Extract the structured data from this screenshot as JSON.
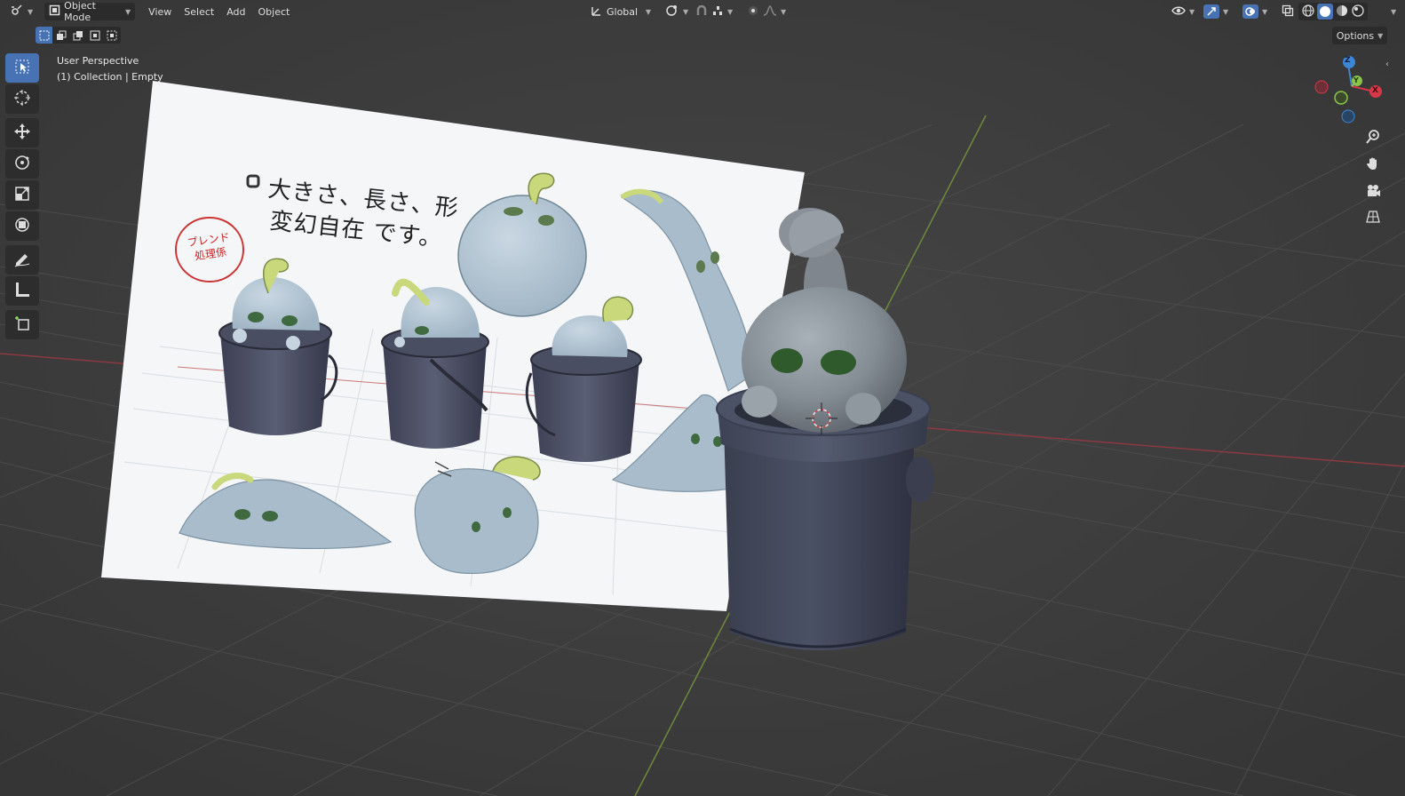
{
  "header": {
    "editor_type_icon": "viewport-editor-icon",
    "mode": "Object Mode",
    "menus": [
      "View",
      "Select",
      "Add",
      "Object"
    ],
    "transform_orientation": "Global",
    "pivot_icon": "pivot-point-icon",
    "snap_icon": "snap-magnet-icon",
    "proportional_icon": "proportional-edit-icon"
  },
  "viewport": {
    "perspective_label": "User Perspective",
    "collection_label": "(1) Collection | Empty",
    "options_label": "Options"
  },
  "gizmo": {
    "z": "Z",
    "y": "Y",
    "x": "X"
  },
  "reference_sheet": {
    "line1": "大きさ、長さ、形",
    "line2": "変幻自在 です。",
    "stamp": "ブレンド\n処理係"
  },
  "toolbar": {
    "tools": [
      "select-box",
      "cursor",
      "move",
      "rotate",
      "scale",
      "transform",
      "annotate",
      "measure",
      "add-cube"
    ]
  },
  "colors": {
    "accent": "#4772b3",
    "background": "#3c3c3c",
    "axis_x": "#d6384a",
    "axis_y": "#8bc34a",
    "axis_z": "#3d86d6"
  }
}
